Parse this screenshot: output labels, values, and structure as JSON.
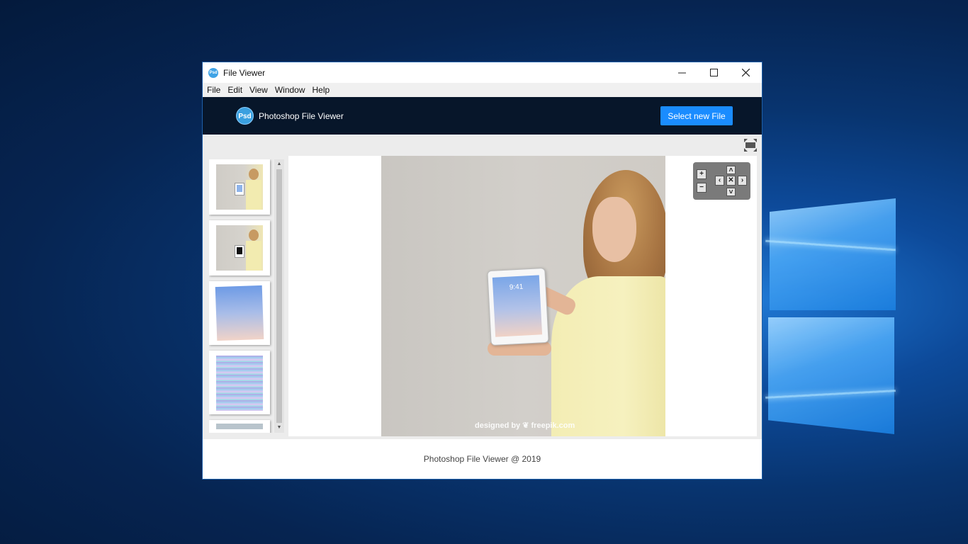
{
  "window": {
    "title": "File Viewer",
    "app_icon_text": "Psd",
    "controls": {
      "minimize": "—",
      "maximize": "☐",
      "close": "✕"
    }
  },
  "menu": [
    "File",
    "Edit",
    "View",
    "Window",
    "Help"
  ],
  "header": {
    "logo_text": "Psd",
    "title": "Photoshop File Viewer",
    "select_button": "Select new File"
  },
  "thumbnails": [
    {
      "name": "woman-holding-tablet-white-screen"
    },
    {
      "name": "woman-holding-tablet-dark-screen"
    },
    {
      "name": "tablet-lockscreen-gradient"
    },
    {
      "name": "striped-pattern-layer"
    },
    {
      "name": "partial-layer"
    }
  ],
  "viewer": {
    "watermark": "designed by ❦ freepik.com",
    "tablet_time": "9:41"
  },
  "nav_panel": {
    "zoom_in": "+",
    "zoom_out": "−",
    "up": "˄",
    "down": "˅",
    "left": "‹",
    "right": "›",
    "reset": "✕"
  },
  "footer": {
    "text": "Photoshop File Viewer @ 2019"
  }
}
